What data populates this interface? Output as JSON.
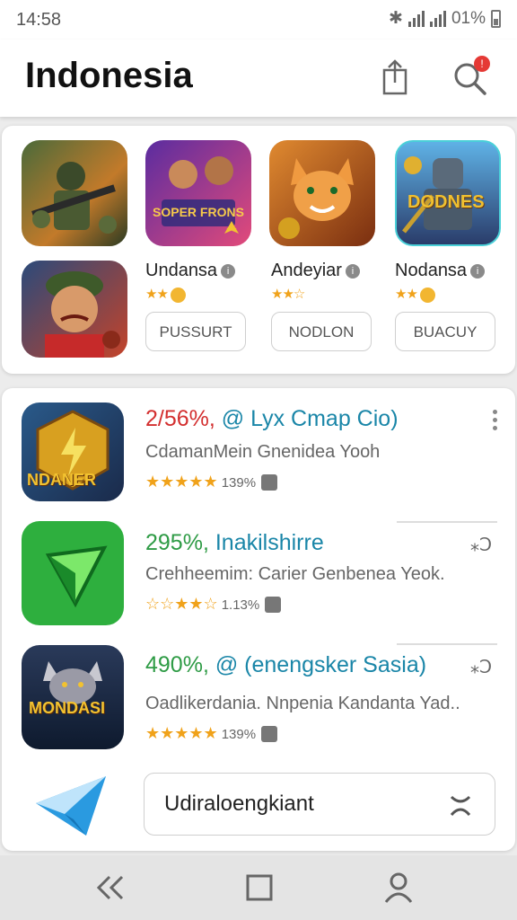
{
  "status": {
    "time": "14:58",
    "battery": "01%"
  },
  "header": {
    "title": "Indonesia",
    "notification_badge": "!"
  },
  "featured": [
    {
      "name": "Undansa",
      "stars": "★★",
      "button": "PUSSURT",
      "icon_text": "",
      "colors": [
        "#3a5a2a",
        "#7b8a4a"
      ]
    },
    {
      "name": "Andeyiar",
      "stars": "★★☆",
      "button": "NODLON",
      "icon_text": "SOPER FRONS",
      "colors": [
        "#5a2ca0",
        "#e24a7a"
      ]
    },
    {
      "name": "Nodansa",
      "stars": "★★",
      "button": "BUACUY",
      "icon_text": "DODNES",
      "colors": [
        "#e07a20",
        "#8a3a14"
      ]
    }
  ],
  "featured_extra_icons": [
    {
      "icon_text": "",
      "colors": [
        "#2b4a7a",
        "#c4432a"
      ]
    },
    {
      "icon_text": "",
      "colors": [
        "#46a0d8",
        "#2a3c6a"
      ]
    }
  ],
  "list": [
    {
      "pct": "2/56%,",
      "name": "@ Lyx Cmap Cio)",
      "desc": "CdamanMein Gnenidea Yooh",
      "stars": "★★★★★",
      "count": "139%",
      "icon_text": "NDANER",
      "pct_color": "red"
    },
    {
      "pct": "295%,",
      "name": "Inakilshirre",
      "desc": "Crehheemim: Carier Genbenea Yeok.",
      "stars": "☆☆★★☆",
      "count": "1.13%",
      "icon_text": "",
      "pct_color": "green"
    },
    {
      "pct": "490%,",
      "name": "@ (enengsker Sasia)",
      "desc": "Oadlikerdania. Nnpenia Kandanta Yad..",
      "stars": "★★★★★",
      "count": "139%",
      "icon_text": "MONDASI",
      "pct_color": "green"
    }
  ],
  "row_actions": [
    "⁎Ↄ",
    "⁎Ↄ"
  ],
  "input": {
    "value": "Udiraloengkiant"
  },
  "nav": {
    "back": "«",
    "home": "",
    "profile": ""
  }
}
